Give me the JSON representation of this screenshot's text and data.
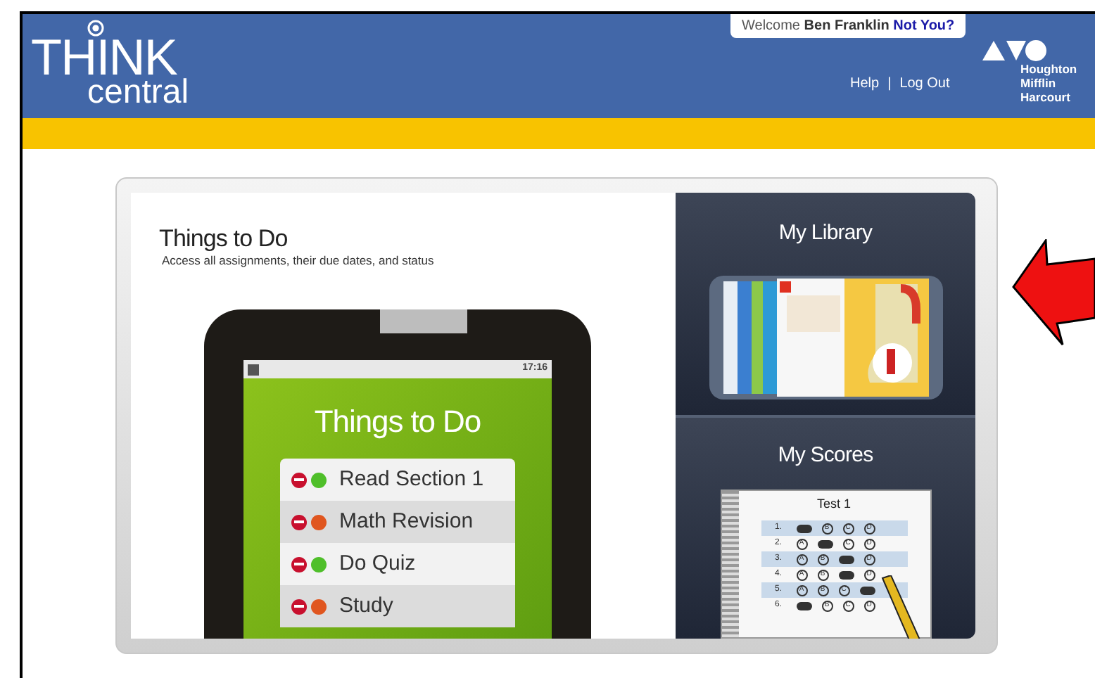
{
  "header": {
    "logo_top": "THINK",
    "logo_bottom": "central",
    "welcome": "Welcome",
    "user": "Ben Franklin",
    "not_you": "Not You?",
    "links": [
      "Help",
      "Log Out"
    ],
    "separator": "|",
    "publisher": [
      "Houghton",
      "Mifflin",
      "Harcourt"
    ]
  },
  "things_to_do": {
    "title": "Things to Do",
    "subtitle": "Access all assignments, their due dates, and status",
    "phone": {
      "time": "17:16",
      "title": "Things to Do",
      "items": [
        {
          "label": "Read Section 1",
          "color": "#4fbf2a"
        },
        {
          "label": "Math Revision",
          "color": "#e0561f"
        },
        {
          "label": "Do Quiz",
          "color": "#4fbf2a"
        },
        {
          "label": "Study",
          "color": "#e0561f"
        }
      ]
    }
  },
  "library": {
    "title": "My Library"
  },
  "scores": {
    "title": "My Scores",
    "sheet": {
      "title": "Test 1",
      "rows": [
        {
          "number": "1.",
          "choices": [
            {
              "filled": true
            },
            {
              "letter": "B",
              "filled": false
            },
            {
              "letter": "C",
              "filled": false
            },
            {
              "letter": "D",
              "filled": false
            }
          ]
        },
        {
          "number": "2.",
          "choices": [
            {
              "letter": "A",
              "filled": false
            },
            {
              "filled": true
            },
            {
              "letter": "C",
              "filled": false
            },
            {
              "letter": "D",
              "filled": false
            }
          ]
        },
        {
          "number": "3.",
          "choices": [
            {
              "letter": "A",
              "filled": false
            },
            {
              "letter": "B",
              "filled": false
            },
            {
              "filled": true
            },
            {
              "letter": "D",
              "filled": false
            }
          ]
        },
        {
          "number": "4.",
          "choices": [
            {
              "letter": "A",
              "filled": false
            },
            {
              "letter": "B",
              "filled": false
            },
            {
              "filled": true
            },
            {
              "letter": "D",
              "filled": false
            }
          ]
        },
        {
          "number": "5.",
          "choices": [
            {
              "letter": "A",
              "filled": false
            },
            {
              "letter": "B",
              "filled": false
            },
            {
              "letter": "C",
              "filled": false
            },
            {
              "filled": true
            }
          ]
        },
        {
          "number": "6.",
          "choices": [
            {
              "filled": true
            },
            {
              "letter": "B",
              "filled": false
            },
            {
              "letter": "C",
              "filled": false
            },
            {
              "letter": "D",
              "filled": false
            }
          ]
        }
      ]
    }
  }
}
